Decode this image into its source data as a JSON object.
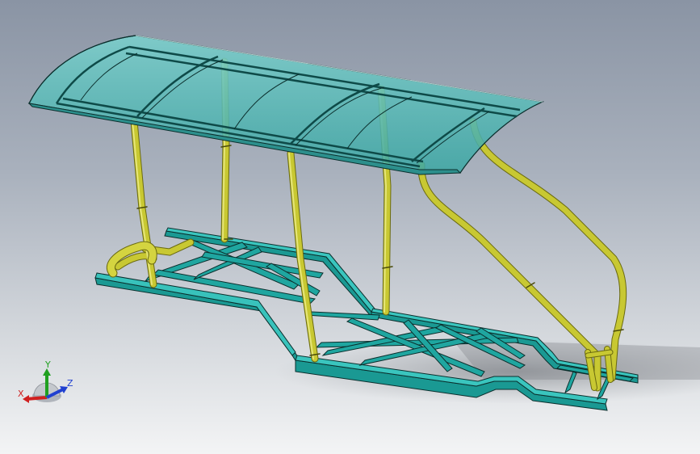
{
  "view": {
    "background_top": "#8a94a4",
    "background_bottom": "#f3f4f5"
  },
  "model": {
    "chassis_color": "#1fa6a0",
    "chassis_edge_color": "#0b2f2d",
    "tube_color": "#c8c832",
    "tube_edge_color": "#6a6a10",
    "canopy_color": "#4fb8b6"
  },
  "triad": {
    "x_label": "X",
    "y_label": "Y",
    "z_label": "Z",
    "x_color": "#d02020",
    "y_color": "#20a020",
    "z_color": "#2040d0"
  }
}
